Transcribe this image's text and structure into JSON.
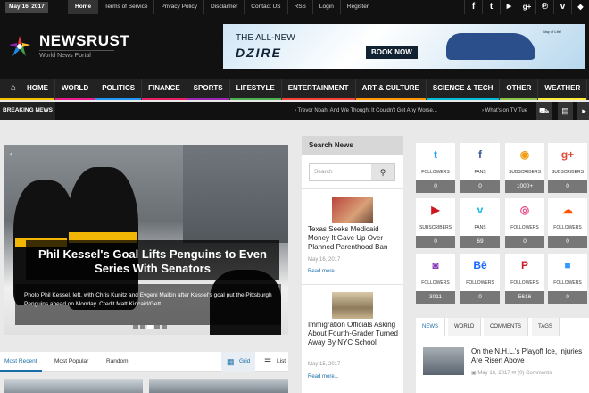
{
  "topbar": {
    "date": "May 16, 2017",
    "links": [
      "Home",
      "Terms of Service",
      "Privacy Policy",
      "Disclaimer",
      "Contact US",
      "RSS",
      "Login",
      "Register"
    ],
    "social_icons": [
      "facebook-icon",
      "twitter-icon",
      "youtube-icon",
      "google-plus-icon",
      "pinterest-icon",
      "vimeo-icon",
      "dropbox-icon"
    ]
  },
  "header": {
    "brand": "NEWSRUST",
    "tagline": "World News Portal",
    "ad": {
      "line1": "THE ALL-NEW",
      "line2": "DZIRE",
      "button": "BOOK NOW",
      "tag": "Way of Life!"
    }
  },
  "nav": {
    "items": [
      {
        "label": "HOME",
        "color": "#f5c000"
      },
      {
        "label": "WORLD",
        "color": "#e91e8c"
      },
      {
        "label": "POLITICS",
        "color": "#2196f3"
      },
      {
        "label": "FINANCE",
        "color": "#e91e63"
      },
      {
        "label": "SPORTS",
        "color": "#9c27b0"
      },
      {
        "label": "LIFESTYLE",
        "color": "#4caf50"
      },
      {
        "label": "ENTERTAINMENT",
        "color": "#f44336"
      },
      {
        "label": "ART & CULTURE",
        "color": "#ff9800"
      },
      {
        "label": "SCIENCE & TECH",
        "color": "#00bcd4"
      },
      {
        "label": "OTHER",
        "color": "#8bc34a"
      },
      {
        "label": "WEATHER",
        "color": "#ffeb3b"
      }
    ]
  },
  "breaking": {
    "label": "BREAKING NEWS",
    "ticker1": "› Trevor Noah: And We Thought It Couldn't Get Any Worse...",
    "ticker2": "› What's on TV Tue"
  },
  "slider": {
    "headline": "Phil Kessel's Goal Lifts Penguins to Even Series With Senators",
    "credit": "Photo Phil Kessel, left, with Chris Kunitz and Evgeni Malkin after Kessel's goal put the Pittsburgh Penguins ahead on Monday. Credit Matt Kincaid/Gett..."
  },
  "tabs": {
    "most_recent": "Most Recent",
    "most_popular": "Most Popular",
    "random": "Random",
    "grid": "Grid",
    "list": "List"
  },
  "search": {
    "heading": "Search News",
    "placeholder": "Search"
  },
  "posts": [
    {
      "title": "Texas Seeks Medicaid Money It Gave Up Over Planned Parenthood Ban",
      "date": "May 16, 2017",
      "more": "Read more..."
    },
    {
      "title": "Immigration Officials Asking About Fourth-Grader Turned Away By NYC School",
      "date": "May 15, 2017",
      "more": "Read more..."
    }
  ],
  "social_counts": [
    {
      "icon": "twitter-icon",
      "glyph": "t",
      "label": "FOLLOWERS",
      "count": "0",
      "color": "#1da1f2"
    },
    {
      "icon": "facebook-icon",
      "glyph": "f",
      "label": "FANS",
      "count": "0",
      "color": "#3b5998"
    },
    {
      "icon": "rss-icon",
      "glyph": "◉",
      "label": "SUBSCRIBERS",
      "count": "1000+",
      "color": "#f39c12"
    },
    {
      "icon": "google-plus-icon",
      "glyph": "g+",
      "label": "SUBSCRIBERS",
      "count": "0",
      "color": "#dd4b39"
    },
    {
      "icon": "youtube-icon",
      "glyph": "▶",
      "label": "SUBSCRIBERS",
      "count": "0",
      "color": "#cc181e"
    },
    {
      "icon": "vimeo-icon",
      "glyph": "v",
      "label": "FANS",
      "count": "69",
      "color": "#1ab7ea"
    },
    {
      "icon": "dribbble-icon",
      "glyph": "◎",
      "label": "FOLLOWERS",
      "count": "0",
      "color": "#ea4c89"
    },
    {
      "icon": "soundcloud-icon",
      "glyph": "☁",
      "label": "FOLLOWERS",
      "count": "0",
      "color": "#ff5500"
    },
    {
      "icon": "instagram-icon",
      "glyph": "◙",
      "label": "FOLLOWERS",
      "count": "3011",
      "color": "#8a3ab9"
    },
    {
      "icon": "behance-icon",
      "glyph": "Bē",
      "label": "FOLLOWERS",
      "count": "0",
      "color": "#1769ff"
    },
    {
      "icon": "pinterest-icon",
      "glyph": "P",
      "label": "FOLLOWERS",
      "count": "5616",
      "color": "#cb2027"
    },
    {
      "icon": "delicious-icon",
      "glyph": "■",
      "label": "FOLLOWERS",
      "count": "0",
      "color": "#3399ff"
    }
  ],
  "news_tabs": {
    "tabs": [
      "NEWS",
      "WORLD",
      "COMMENTS",
      "TAGS"
    ],
    "item": {
      "title": "On the N.H.L.'s Playoff Ice, Injuries Are Risen Above",
      "date": "May 16, 2017",
      "comments": "(0) Comments"
    }
  }
}
